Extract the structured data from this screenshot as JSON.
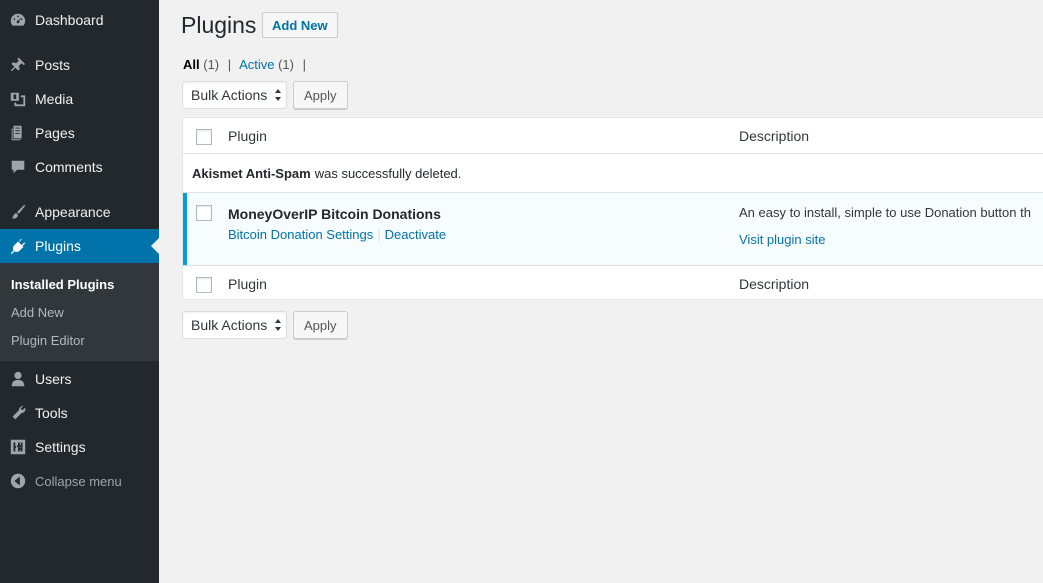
{
  "sidebar": {
    "items": [
      {
        "label": "Dashboard",
        "icon": "dashboard-icon"
      },
      {
        "label": "Posts",
        "icon": "pin-icon"
      },
      {
        "label": "Media",
        "icon": "media-icon"
      },
      {
        "label": "Pages",
        "icon": "pages-icon"
      },
      {
        "label": "Comments",
        "icon": "comment-icon"
      },
      {
        "label": "Appearance",
        "icon": "brush-icon"
      },
      {
        "label": "Plugins",
        "icon": "plugin-icon"
      },
      {
        "label": "Users",
        "icon": "user-icon"
      },
      {
        "label": "Tools",
        "icon": "wrench-icon"
      },
      {
        "label": "Settings",
        "icon": "settings-icon"
      }
    ],
    "submenu": [
      "Installed Plugins",
      "Add New",
      "Plugin Editor"
    ],
    "collapse_label": "Collapse menu",
    "accent_color": "#0073aa"
  },
  "header": {
    "title": "Plugins",
    "add_new_label": "Add New"
  },
  "filters": {
    "all_label": "All",
    "all_count": "(1)",
    "active_label": "Active",
    "active_count": "(1)",
    "separator": "|"
  },
  "bulk": {
    "select_value": "Bulk Actions",
    "apply_label": "Apply"
  },
  "table": {
    "columns": [
      "Plugin",
      "Description"
    ],
    "notice": {
      "plugin": "Akismet Anti-Spam",
      "message": "was successfully deleted."
    },
    "plugins": [
      {
        "name": "MoneyOverIP Bitcoin Donations",
        "actions": [
          "Bitcoin Donation Settings",
          "Deactivate"
        ],
        "description": "An easy to install, simple to use Donation button th",
        "site_link": "Visit plugin site"
      }
    ]
  }
}
